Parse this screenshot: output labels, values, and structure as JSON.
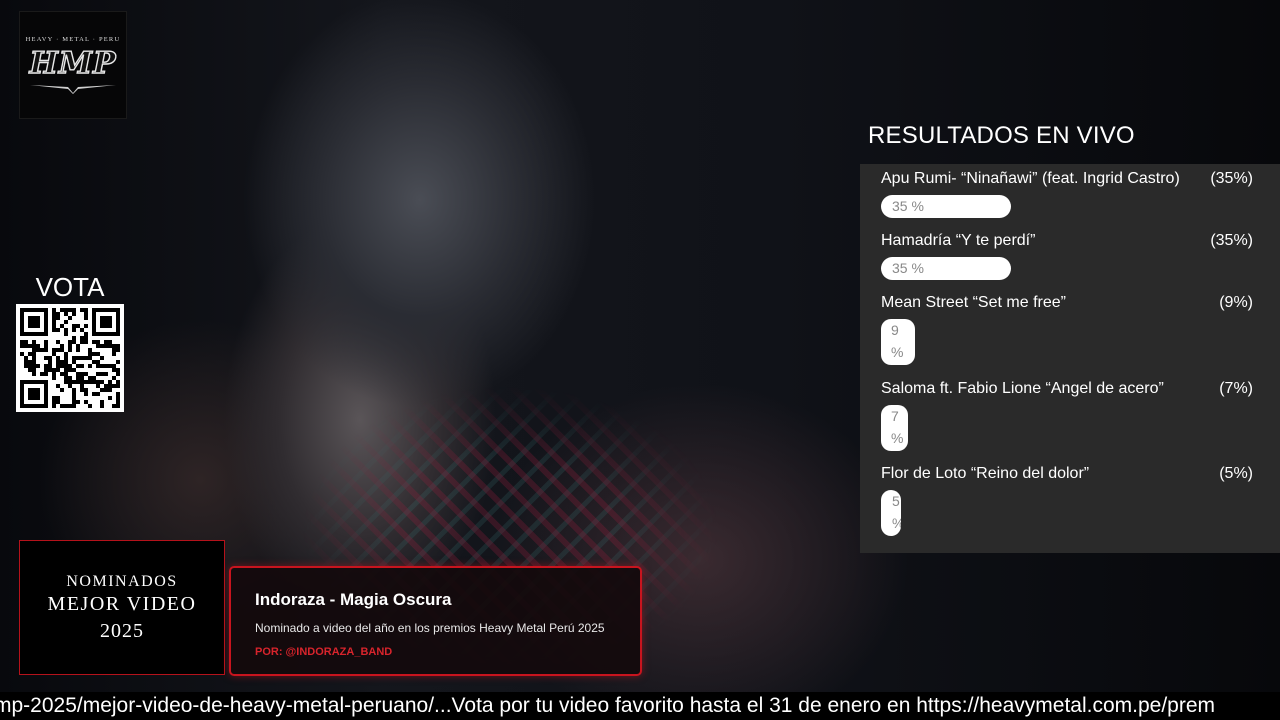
{
  "logo": {
    "top_text": "HEAVY · METAL · PERU",
    "mark": "HMP"
  },
  "vote": {
    "label": "VOTA",
    "qr_icon": "qr-code-icon"
  },
  "results": {
    "title": "RESULTADOS EN VIVO",
    "items": [
      {
        "name": "Apu Rumi- “Ninañawi” (feat. Ingrid Castro)",
        "pct": "(35%)",
        "bar_label": "35 %",
        "value": 35
      },
      {
        "name": "Hamadría “Y te perdí”",
        "pct": "(35%)",
        "bar_label": "35 %",
        "value": 35
      },
      {
        "name": "Mean Street “Set me free”",
        "pct": "(9%)",
        "bar_label": "9 %",
        "value": 9
      },
      {
        "name": "Saloma ft. Fabio Lione “Angel de acero”",
        "pct": "(7%)",
        "bar_label": "7 %",
        "value": 7
      },
      {
        "name": "Flor de Loto “Reino del dolor”",
        "pct": "(5%)",
        "bar_label": "5 %",
        "value": 5
      }
    ]
  },
  "nominados": {
    "line1": "NOMINADOS",
    "line2": "MEJOR VIDEO",
    "line3": "2025"
  },
  "card": {
    "title": "Indoraza - Magia Oscura",
    "subtitle": "Nominado a video del año en los premios Heavy Metal Perú 2025",
    "by": "POR: @INDORAZA_BAND"
  },
  "ticker": {
    "text": "mp-2025/mejor-video-de-heavy-metal-peruano/...Vota por tu video favorito hasta el 31 de enero en https://heavymetal.com.pe/prem"
  },
  "colors": {
    "accent_red": "#c8141e",
    "panel": "#2a2a2a"
  }
}
